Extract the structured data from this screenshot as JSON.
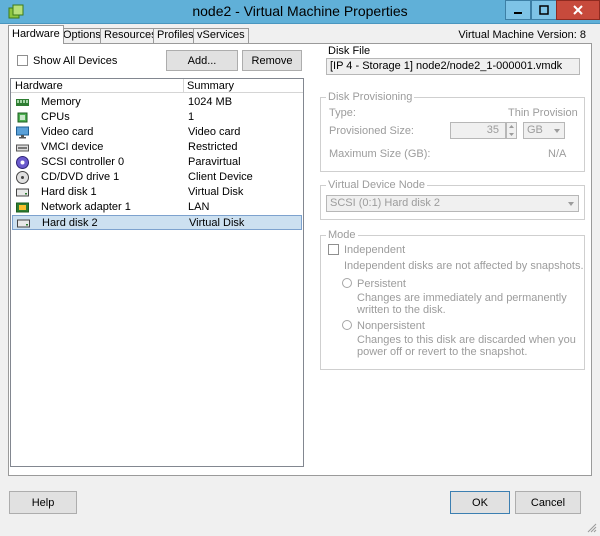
{
  "window": {
    "title": "node2 - Virtual Machine Properties",
    "icon": "vm-app-icon",
    "controls": [
      "minimize-icon",
      "maximize-icon",
      "close-icon"
    ]
  },
  "tabs": [
    {
      "label": "Hardware",
      "active": true
    },
    {
      "label": "Options",
      "active": false
    },
    {
      "label": "Resources",
      "active": false
    },
    {
      "label": "Profiles",
      "active": false
    },
    {
      "label": "vServices",
      "active": false
    }
  ],
  "vm_version": "Virtual Machine Version: 8",
  "left": {
    "show_all_label": "Show All Devices",
    "show_all_checked": false,
    "add_label": "Add...",
    "remove_label": "Remove",
    "columns": [
      "Hardware",
      "Summary"
    ],
    "devices": [
      {
        "name": "Memory",
        "summary": "1024 MB",
        "icon": "memory-icon",
        "selected": false
      },
      {
        "name": "CPUs",
        "summary": "1",
        "icon": "cpu-icon",
        "selected": false
      },
      {
        "name": "Video card",
        "summary": "Video card",
        "icon": "monitor-icon",
        "selected": false
      },
      {
        "name": "VMCI device",
        "summary": "Restricted",
        "icon": "vmci-icon",
        "selected": false
      },
      {
        "name": "SCSI controller 0",
        "summary": "Paravirtual",
        "icon": "scsi-icon",
        "selected": false
      },
      {
        "name": "CD/DVD drive 1",
        "summary": "Client Device",
        "icon": "cd-icon",
        "selected": false
      },
      {
        "name": "Hard disk 1",
        "summary": "Virtual Disk",
        "icon": "hard-disk-icon",
        "selected": false
      },
      {
        "name": "Network adapter 1",
        "summary": "LAN",
        "icon": "network-icon",
        "selected": false
      },
      {
        "name": "Hard disk 2",
        "summary": "Virtual Disk",
        "icon": "hard-disk-icon",
        "selected": true
      }
    ]
  },
  "disk_file": {
    "title": "Disk File",
    "value": "[IP 4 - Storage 1] node2/node2_1-000001.vmdk"
  },
  "disk_provisioning": {
    "title": "Disk Provisioning",
    "type_label": "Type:",
    "type_value": "Thin Provision",
    "size_label": "Provisioned Size:",
    "size_value": "35",
    "size_unit": "GB",
    "max_label": "Maximum Size (GB):",
    "max_value": "N/A"
  },
  "virtual_device_node": {
    "title": "Virtual Device Node",
    "value": "SCSI (0:1) Hard disk 2"
  },
  "mode": {
    "title": "Mode",
    "independent_label": "Independent",
    "independent_note": "Independent disks are not affected by snapshots.",
    "persistent_label": "Persistent",
    "persistent_desc": "Changes are immediately and permanently written to the disk.",
    "nonpersistent_label": "Nonpersistent",
    "nonpersistent_desc": "Changes to this disk are discarded when you power off or revert to the snapshot."
  },
  "footer": {
    "help_label": "Help",
    "ok_label": "OK",
    "cancel_label": "Cancel"
  },
  "colors": {
    "titlebar": "#60b0d8",
    "selection": "#cce0f0",
    "close_button": "#c74a3c"
  }
}
